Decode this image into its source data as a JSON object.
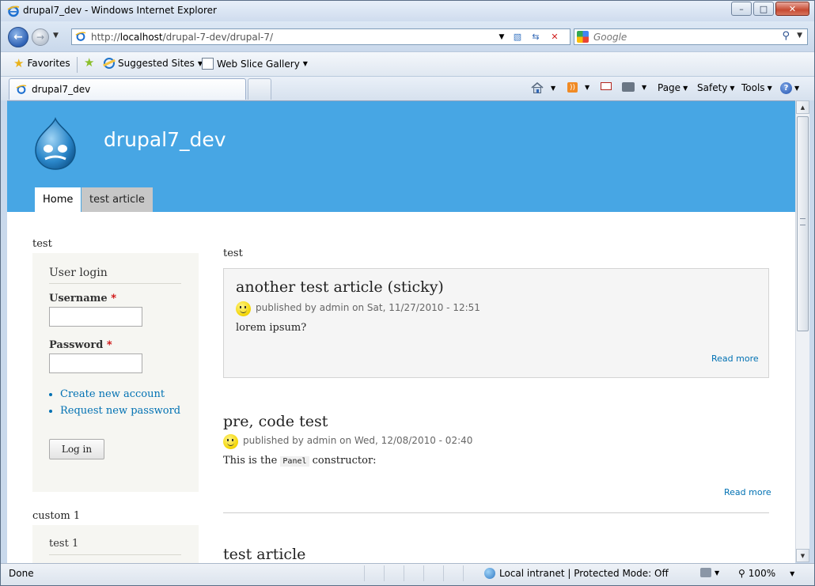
{
  "window": {
    "title": "drupal7_dev - Windows Internet Explorer",
    "buttons": [
      "–",
      "□",
      "✕"
    ]
  },
  "address_bar": {
    "url_prefix": "http://",
    "url_host": "localhost",
    "url_path": "/drupal-7-dev/drupal-7/"
  },
  "search": {
    "placeholder": "Google"
  },
  "favorites_bar": {
    "favorites_label": "Favorites",
    "suggested_sites_label": "Suggested Sites",
    "web_slice_label": "Web Slice Gallery"
  },
  "tabs": {
    "active_label": "drupal7_dev"
  },
  "command_bar": {
    "page_label": "Page",
    "safety_label": "Safety",
    "tools_label": "Tools",
    "help_glyph": "?"
  },
  "site": {
    "name": "drupal7_dev",
    "primary_tabs": [
      "Home",
      "test article"
    ]
  },
  "sidebar": {
    "region_title": "test",
    "login_block": {
      "title": "User login",
      "username_label": "Username",
      "password_label": "Password",
      "required_mark": "*",
      "links": [
        "Create new account",
        "Request new password"
      ],
      "submit_label": "Log in"
    },
    "custom_region_title": "custom 1",
    "custom_block_title": "test 1"
  },
  "main": {
    "region_title": "test",
    "nodes": [
      {
        "title": "another test article (sticky)",
        "meta": "published by admin on Sat, 11/27/2010 - 12:51",
        "body": "lorem ipsum?",
        "read_more": "Read more"
      },
      {
        "title": "pre, code test",
        "meta": "published by admin on Wed, 12/08/2010 - 02:40",
        "body_before": "This is the",
        "body_code": "Panel",
        "body_after": "constructor:",
        "read_more": "Read more"
      },
      {
        "title": "test article"
      }
    ]
  },
  "status_bar": {
    "text": "Done",
    "zone": "Local intranet | Protected Mode: Off",
    "zoom": "100%"
  }
}
